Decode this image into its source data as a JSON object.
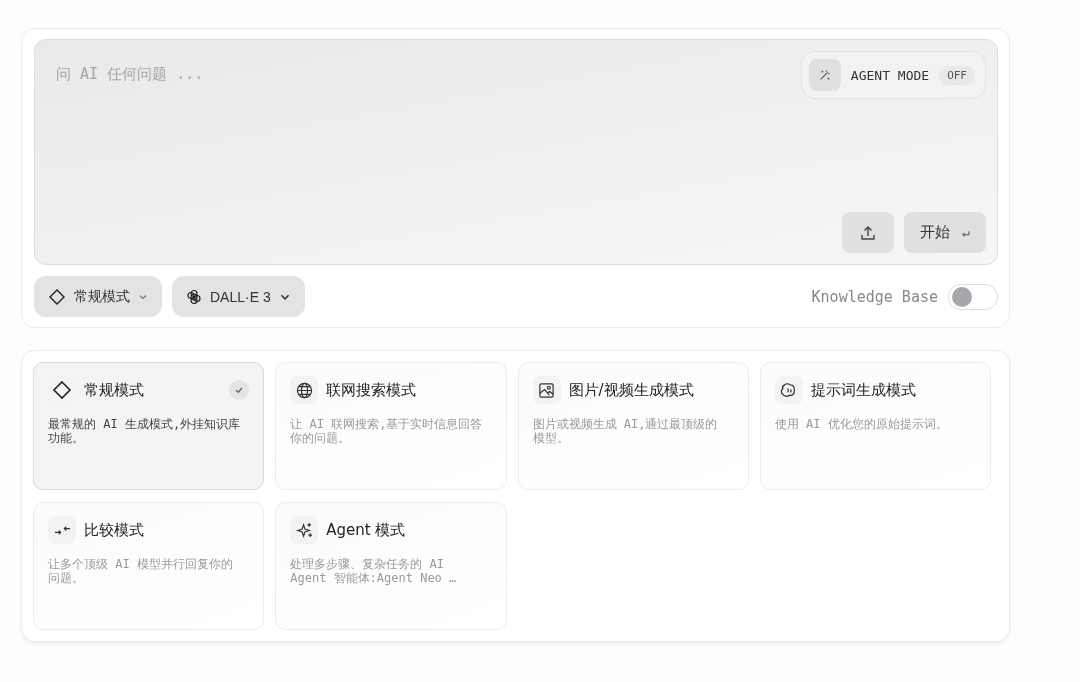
{
  "prompt": {
    "placeholder": "问 AI 任何问题 ..."
  },
  "agent_mode": {
    "label": "AGENT MODE",
    "state": "OFF"
  },
  "submit_button": {
    "label": "开始",
    "key": "↵"
  },
  "mode_select": {
    "label": "常规模式"
  },
  "model_select": {
    "label": "DALL·E 3"
  },
  "knowledge_base": {
    "label": "Knowledge Base",
    "on": false
  },
  "modes": [
    {
      "kind": "regular",
      "title": "常规模式",
      "description": "最常规的 AI 生成模式,外挂知识库功能。",
      "selected": true
    },
    {
      "kind": "web",
      "title": "联网搜索模式",
      "description": "让 AI 联网搜索,基于实时信息回答你的问题。",
      "selected": false
    },
    {
      "kind": "image",
      "title": "图片/视频生成模式",
      "description": "图片或视频生成 AI,通过最顶级的模型。",
      "selected": false
    },
    {
      "kind": "prompt",
      "title": "提示词生成模式",
      "description": "使用 AI 优化您的原始提示词。",
      "selected": false
    },
    {
      "kind": "compare",
      "title": "比较模式",
      "description": "让多个顶级 AI 模型并行回复你的问题。",
      "selected": false
    },
    {
      "kind": "agent",
      "title": "Agent 模式",
      "description": "处理多步骤、复杂任务的 AI Agent 智能体:Agent Neo …",
      "selected": false
    }
  ]
}
